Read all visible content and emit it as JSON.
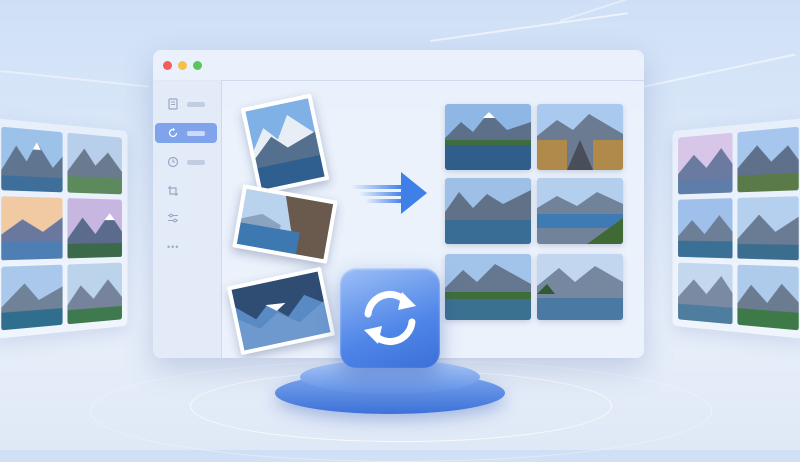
{
  "window": {
    "controls": [
      "close",
      "minimize",
      "maximize"
    ],
    "colors": {
      "close": "#f0605a",
      "minimize": "#f5c04a",
      "maximize": "#5cc45b"
    }
  },
  "sidebar": {
    "items": [
      {
        "icon": "document-icon",
        "active": false
      },
      {
        "icon": "rotate-icon",
        "active": true
      },
      {
        "icon": "clock-icon",
        "active": false
      },
      {
        "icon": "crop-icon",
        "active": false
      },
      {
        "icon": "sliders-icon",
        "active": false
      },
      {
        "icon": "more-icon",
        "active": false
      }
    ],
    "more_label": "•••"
  },
  "main": {
    "input_photos": 3,
    "output_images": 6,
    "arrow_icon": "arrow-right-icon",
    "center_badge_icon": "sync-icon"
  },
  "colors": {
    "accent": "#3f7fe8",
    "active_sidebar": "#7fa4ec"
  }
}
